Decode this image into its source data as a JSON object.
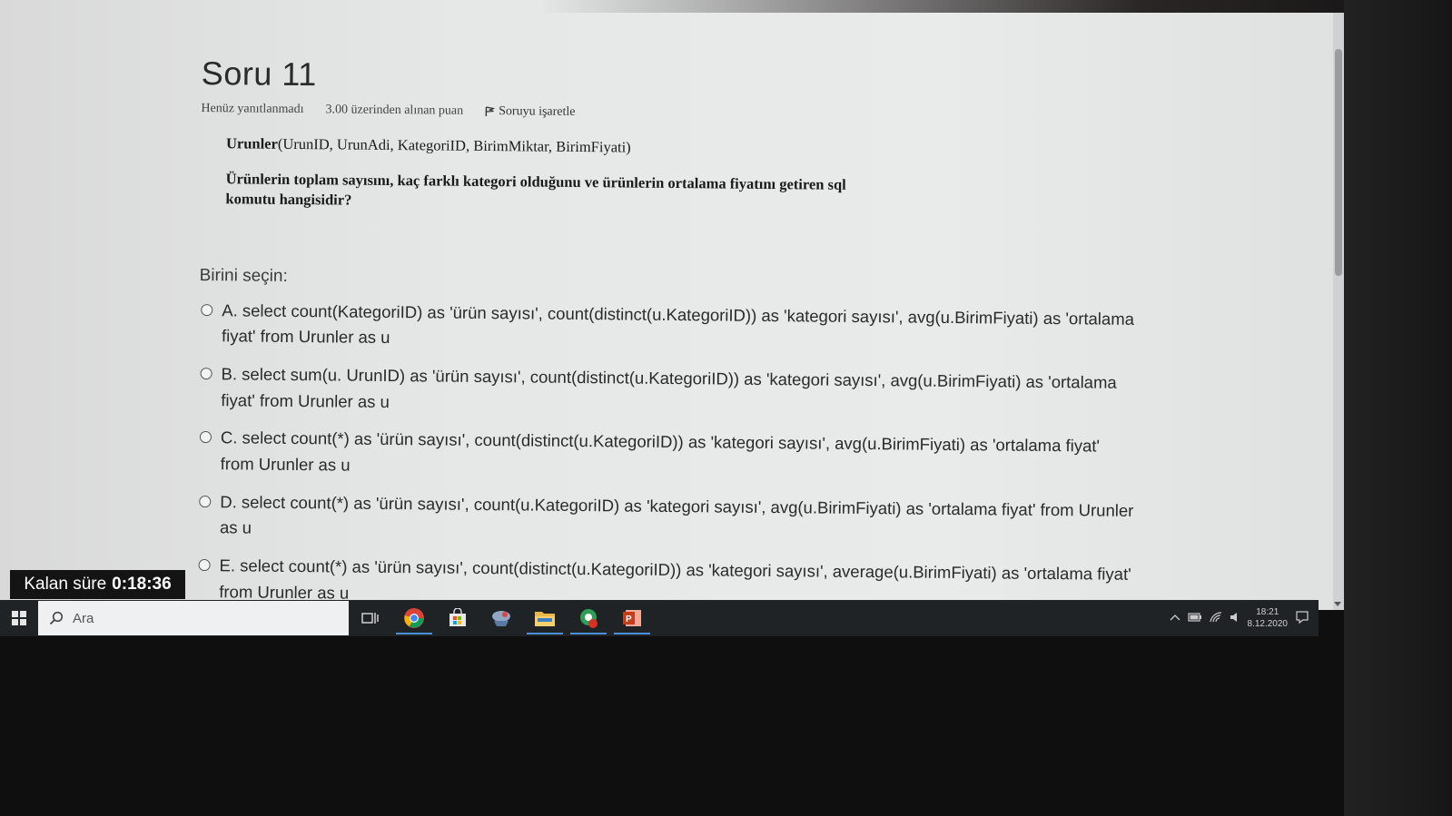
{
  "question": {
    "title": "Soru 11",
    "status": "Henüz yanıtlanmadı",
    "points": "3.00 üzerinden alınan puan",
    "flag_label": "Soruyu işaretle",
    "schema_bold": "Urunler",
    "schema_rest": "(UrunID, UrunAdi, KategoriID, BirimMiktar, BirimFiyati)",
    "text": "Ürünlerin toplam sayısını, kaç farklı kategori olduğunu ve ürünlerin ortalama fiyatını getiren sql komutu hangisidir?"
  },
  "choose_label": "Birini seçin:",
  "options": [
    {
      "text": "A. select count(KategoriID) as 'ürün sayısı', count(distinct(u.KategoriID)) as 'kategori sayısı', avg(u.BirimFiyati) as 'ortalama fiyat' from Urunler as u"
    },
    {
      "text": "B. select sum(u. UrunID) as 'ürün sayısı', count(distinct(u.KategoriID)) as 'kategori sayısı', avg(u.BirimFiyati) as 'ortalama fiyat' from Urunler as u"
    },
    {
      "text": "C. select count(*) as 'ürün sayısı', count(distinct(u.KategoriID)) as 'kategori sayısı', avg(u.BirimFiyati) as 'ortalama fiyat' from Urunler as u"
    },
    {
      "text": "D. select count(*) as 'ürün sayısı', count(u.KategoriID) as 'kategori sayısı', avg(u.BirimFiyati) as 'ortalama fiyat' from Urunler as u"
    },
    {
      "text": "E. select count(*) as 'ürün sayısı', count(distinct(u.KategoriID)) as 'kategori sayısı', average(u.BirimFiyati) as 'ortalama fiyat' from Urunler as u"
    }
  ],
  "timer": {
    "label": "Kalan süre",
    "value": "0:18:36"
  },
  "taskbar": {
    "search_placeholder": "Ara",
    "apps": [
      "task-view",
      "chrome",
      "store",
      "app",
      "file-explorer",
      "app",
      "powerpoint"
    ],
    "clock_time": "18:21",
    "clock_date": "8.12.2020"
  },
  "colors": {
    "page_bg": "#e7e9e9",
    "taskbar": "#1f2326",
    "timer_bg": "#141414",
    "accent": "#4a90d9"
  }
}
